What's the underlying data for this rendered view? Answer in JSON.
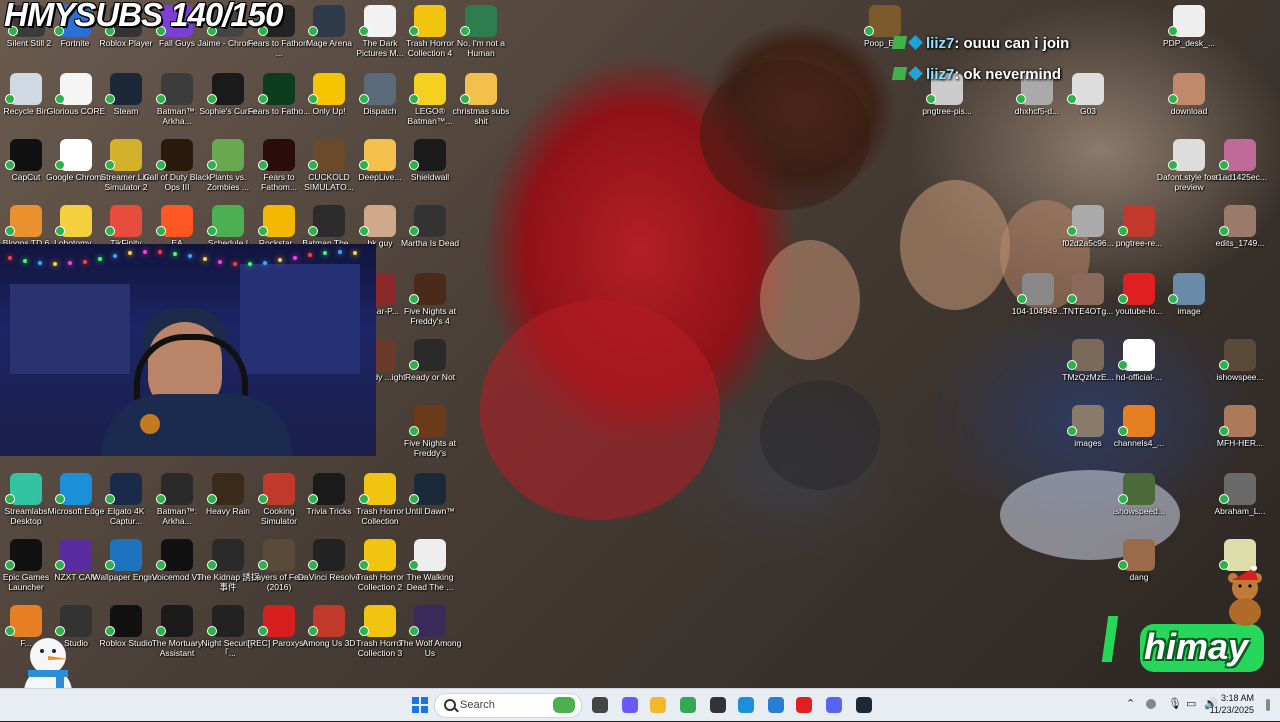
{
  "stream": {
    "title": "HMYSUBS 140/150"
  },
  "desktop_icons": [
    {
      "label": "Silent Still 2",
      "icon": "silent-still-icon",
      "color": "#3a3a3a"
    },
    {
      "label": "Fortnite",
      "icon": "fortnite-icon",
      "color": "#2c6fd6"
    },
    {
      "label": "Roblox Player",
      "icon": "roblox-icon",
      "color": "#333333"
    },
    {
      "label": "Fall Guys",
      "icon": "fall-guys-icon",
      "color": "#7b3fd6"
    },
    {
      "label": "Jaime - Chrome",
      "icon": "chrome-profile-icon",
      "color": "#444444"
    },
    {
      "label": "Fears to Fathom ...",
      "icon": "fears-to-fathom-icon",
      "color": "#222222"
    },
    {
      "label": "Mage Arena",
      "icon": "mage-arena-icon",
      "color": "#2f3a4a"
    },
    {
      "label": "The Dark Pictures M...",
      "icon": "document-icon",
      "color": "#f2f2f2"
    },
    {
      "label": "Trash Horror Collection 4",
      "icon": "trash-horror-icon",
      "color": "#f1c40f"
    },
    {
      "label": "No, I'm not a Human",
      "icon": "no-im-not-human-icon",
      "color": "#2e7d4f"
    },
    {
      "label": "Recycle Bin",
      "icon": "recycle-bin-icon",
      "color": "#cfd8e3"
    },
    {
      "label": "Glorious CORE",
      "icon": "glorious-core-icon",
      "color": "#f5f5f5"
    },
    {
      "label": "Steam",
      "icon": "steam-icon",
      "color": "#1b2838"
    },
    {
      "label": "Batman™: Arkha...",
      "icon": "batman-icon",
      "color": "#3c3c3c"
    },
    {
      "label": "Sophie's Curse",
      "icon": "sophies-curse-icon",
      "color": "#1a1a1a"
    },
    {
      "label": "Fears to Fatho...",
      "icon": "f2f-icon",
      "color": "#0c3d1d"
    },
    {
      "label": "Only Up!",
      "icon": "only-up-icon",
      "color": "#f6c400"
    },
    {
      "label": "Dispatch",
      "icon": "dispatch-icon",
      "color": "#5a6a7a"
    },
    {
      "label": "LEGO® Batman™...",
      "icon": "lego-batman-icon",
      "color": "#f5d020"
    },
    {
      "label": "christmas subs shit",
      "icon": "folder-icon",
      "color": "#f3c14b"
    },
    {
      "label": "CapCut",
      "icon": "capcut-icon",
      "color": "#111111"
    },
    {
      "label": "Google Chrome",
      "icon": "chrome-icon",
      "color": "#ffffff"
    },
    {
      "label": "Streamer Life Simulator 2",
      "icon": "streamer-life-icon",
      "color": "#d4b12a"
    },
    {
      "label": "Call of Duty Black Ops III",
      "icon": "cod-icon",
      "color": "#2a1a0c"
    },
    {
      "label": "Plants vs. Zombies ...",
      "icon": "pvz-icon",
      "color": "#6aa84f"
    },
    {
      "label": "Fears to Fathom...",
      "icon": "f2f-red-icon",
      "color": "#2b0c0c"
    },
    {
      "label": "CUCKOLD SIMULATO...",
      "icon": "cuckold-sim-icon",
      "color": "#6a4a2a"
    },
    {
      "label": "DeepLive...",
      "icon": "folder-icon",
      "color": "#f3c14b"
    },
    {
      "label": "Shieldwall",
      "icon": "shieldwall-icon",
      "color": "#1a1a1a"
    },
    {
      "label": "Bloons TD 6",
      "icon": "bloons-icon",
      "color": "#e8912d"
    },
    {
      "label": "Lobotomy...",
      "icon": "lobotomy-icon",
      "color": "#f4d03f"
    },
    {
      "label": "TikFinity",
      "icon": "tikfinity-icon",
      "color": "#e74c3c"
    },
    {
      "label": "EA",
      "icon": "ea-icon",
      "color": "#ff5722"
    },
    {
      "label": "Schedule I",
      "icon": "schedule-icon",
      "color": "#4caf50"
    },
    {
      "label": "Rockstar...",
      "icon": "rockstar-icon",
      "color": "#f5b800"
    },
    {
      "label": "Batman The...",
      "icon": "batman-telltale-icon",
      "color": "#2c2c2c"
    },
    {
      "label": "bk guy",
      "icon": "image-file-icon",
      "color": "#cfa98a"
    },
    {
      "label": "Martha Is Dead",
      "icon": "martha-icon",
      "color": "#333333"
    },
    {
      "label": "...-Bar-P...",
      "icon": "bar-icon",
      "color": "#8a2a2a"
    },
    {
      "label": "Five Nights at Freddy's 4",
      "icon": "fnaf4-icon",
      "color": "#4a2a1a"
    },
    {
      "label": "...medy ...ight",
      "icon": "comedy-icon",
      "color": "#6a3a2a"
    },
    {
      "label": "Ready or Not",
      "icon": "ready-or-not-icon",
      "color": "#2a2a2a"
    },
    {
      "label": "Five Nights at Freddy's",
      "icon": "fnaf-icon",
      "color": "#6a3a1a"
    },
    {
      "label": "Streamlabs Desktop",
      "icon": "streamlabs-icon",
      "color": "#31c3a2"
    },
    {
      "label": "Microsoft Edge",
      "icon": "edge-icon",
      "color": "#1b8fd8"
    },
    {
      "label": "Elgato 4K Captur...",
      "icon": "elgato-icon",
      "color": "#1a2a4a"
    },
    {
      "label": "Batman™: Arkha...",
      "icon": "batman-arkham-icon",
      "color": "#2a2a2a"
    },
    {
      "label": "Heavy Rain",
      "icon": "heavy-rain-icon",
      "color": "#3a2a1a"
    },
    {
      "label": "Cooking Simulator",
      "icon": "cooking-sim-icon",
      "color": "#c0392b"
    },
    {
      "label": "Trivia Tricks",
      "icon": "trivia-icon",
      "color": "#1a1a1a"
    },
    {
      "label": "Trash Horror Collection",
      "icon": "trash-horror-1-icon",
      "color": "#f1c40f"
    },
    {
      "label": "Until Dawn™",
      "icon": "until-dawn-icon",
      "color": "#1a2a3a"
    },
    {
      "label": "Epic Games Launcher",
      "icon": "epic-games-icon",
      "color": "#111111"
    },
    {
      "label": "NZXT CAM",
      "icon": "nzxt-icon",
      "color": "#5a2ca0"
    },
    {
      "label": "Wallpaper Engine",
      "icon": "wallpaper-engine-icon",
      "color": "#1e73be"
    },
    {
      "label": "Voicemod V3",
      "icon": "voicemod-icon",
      "color": "#111111"
    },
    {
      "label": "The Kidnap 誘拐事件",
      "icon": "kidnap-icon",
      "color": "#2a2a2a"
    },
    {
      "label": "Layers of Fear (2016)",
      "icon": "layers-of-fear-icon",
      "color": "#5a4a3a"
    },
    {
      "label": "DaVinci Resolve",
      "icon": "davinci-icon",
      "color": "#222222"
    },
    {
      "label": "Trash Horror Collection 2",
      "icon": "trash-horror-2-icon",
      "color": "#f1c40f"
    },
    {
      "label": "The Walking Dead The ...",
      "icon": "walking-dead-icon",
      "color": "#eeeeee"
    },
    {
      "label": "F...",
      "icon": "f-icon",
      "color": "#e67e22"
    },
    {
      "label": "Studio",
      "icon": "obs-icon",
      "color": "#333333"
    },
    {
      "label": "Roblox Studio",
      "icon": "roblox-studio-icon",
      "color": "#111111"
    },
    {
      "label": "The Mortuary Assistant",
      "icon": "mortuary-icon",
      "color": "#1a1a1a"
    },
    {
      "label": "Night Security 「...",
      "icon": "night-security-icon",
      "color": "#222222"
    },
    {
      "label": "[REC] Paroxysm",
      "icon": "rec-icon",
      "color": "#d62020"
    },
    {
      "label": "Among Us 3D",
      "icon": "among-us-icon",
      "color": "#c0392b"
    },
    {
      "label": "Trash Horror Collection 3",
      "icon": "trash-horror-3-icon",
      "color": "#f1c40f"
    },
    {
      "label": "The Wolf Among Us",
      "icon": "wolf-among-us-icon",
      "color": "#3a2a5a"
    },
    {
      "label": "Poop_En...",
      "icon": "poop-icon",
      "color": "#7a5a2a"
    },
    {
      "label": "pngtree-pis...",
      "icon": "png-file-icon",
      "color": "#cccccc"
    },
    {
      "label": "dhxhcf5-d...",
      "icon": "image-file-icon",
      "color": "#aaaaaa"
    },
    {
      "label": "G03",
      "icon": "image-file-icon",
      "color": "#dddddd"
    },
    {
      "label": "PDP_desk_...",
      "icon": "pdp-icon",
      "color": "#eeeeee"
    },
    {
      "label": "download",
      "icon": "download-icon",
      "color": "#c08a6a"
    },
    {
      "label": "Dafont.style font-preview",
      "icon": "font-preview-icon",
      "color": "#dddddd"
    },
    {
      "label": "a1ad1425ec...",
      "icon": "image-file-icon",
      "color": "#c06a9a"
    },
    {
      "label": "f02d2a5c96...",
      "icon": "image-file-icon",
      "color": "#aaaaaa"
    },
    {
      "label": "pngtree-re...",
      "icon": "png-file-icon",
      "color": "#c0392b"
    },
    {
      "label": "edits_1749...",
      "icon": "image-file-icon",
      "color": "#9a7a6a"
    },
    {
      "label": "104-104949...",
      "icon": "image-file-icon",
      "color": "#888888"
    },
    {
      "label": "TNTE4OTg...",
      "icon": "image-file-icon",
      "color": "#8a6a5a"
    },
    {
      "label": "youtube-lo...",
      "icon": "youtube-file-icon",
      "color": "#e02020"
    },
    {
      "label": "image",
      "icon": "image-file-icon",
      "color": "#6a8aaa"
    },
    {
      "label": "TMzQzMzE...",
      "icon": "image-file-icon",
      "color": "#7a6a5a"
    },
    {
      "label": "hd-official-...",
      "icon": "youtube-file-icon",
      "color": "#ffffff"
    },
    {
      "label": "ishowspee...",
      "icon": "image-file-icon",
      "color": "#5a4a3a"
    },
    {
      "label": "images",
      "icon": "image-file-icon",
      "color": "#8a7a6a"
    },
    {
      "label": "channels4_...",
      "icon": "image-file-icon",
      "color": "#e67e22"
    },
    {
      "label": "MFH-HER...",
      "icon": "image-file-icon",
      "color": "#aa7a5a"
    },
    {
      "label": "ishowspeed...",
      "icon": "image-file-icon",
      "color": "#4a6a3a"
    },
    {
      "label": "Abraham_L...",
      "icon": "image-file-icon",
      "color": "#6a6a6a"
    },
    {
      "label": "dang",
      "icon": "image-file-icon",
      "color": "#9a6a4a"
    },
    {
      "label": "",
      "icon": "image-file-icon",
      "color": "#ddddaa"
    }
  ],
  "chat": [
    {
      "user": "liiz7",
      "message": ": ouuu can i join"
    },
    {
      "user": "liiz7",
      "message": ": ok nevermind"
    }
  ],
  "overlay": {
    "brand": "himay"
  },
  "taskbar": {
    "search_placeholder": "Search",
    "time": "3:18 AM",
    "date": "11/23/2025",
    "apps": [
      {
        "icon": "windows-start-icon",
        "color": "#1a73e8"
      },
      {
        "icon": "task-view-icon",
        "color": "#444444"
      },
      {
        "icon": "copilot-icon",
        "color": "#6a5af9"
      },
      {
        "icon": "file-explorer-icon",
        "color": "#f3b829"
      },
      {
        "icon": "chrome-taskbar-icon",
        "color": "#34a853"
      },
      {
        "icon": "obs-taskbar-icon",
        "color": "#333333"
      },
      {
        "icon": "edge-taskbar-icon",
        "color": "#1b8fd8"
      },
      {
        "icon": "store-taskbar-icon",
        "color": "#2b7cd3"
      },
      {
        "icon": "youtube-taskbar-icon",
        "color": "#e02020"
      },
      {
        "icon": "discord-taskbar-icon",
        "color": "#5865f2"
      },
      {
        "icon": "steam-taskbar-icon",
        "color": "#1b2838"
      }
    ]
  }
}
